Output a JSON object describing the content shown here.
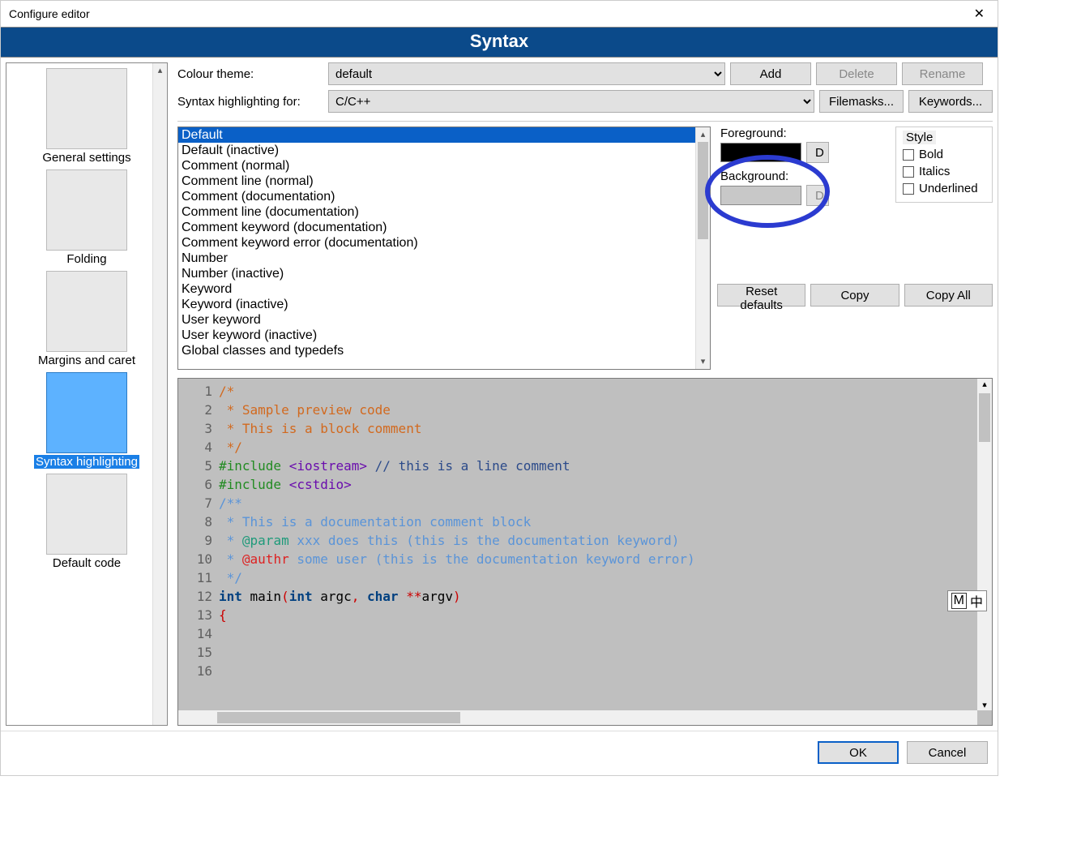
{
  "window": {
    "title": "Configure editor"
  },
  "page_title": "Syntax",
  "sidebar": {
    "items": [
      {
        "label": "General settings",
        "selected": false
      },
      {
        "label": "Folding",
        "selected": false
      },
      {
        "label": "Margins and caret",
        "selected": false
      },
      {
        "label": "Syntax highlighting",
        "selected": true
      },
      {
        "label": "Default code",
        "selected": false
      }
    ]
  },
  "colour_theme": {
    "label": "Colour theme:",
    "value": "default"
  },
  "syntax_for": {
    "label": "Syntax highlighting for:",
    "value": "C/C++"
  },
  "buttons": {
    "add": "Add",
    "delete": "Delete",
    "rename": "Rename",
    "filemasks": "Filemasks...",
    "keywords": "Keywords...",
    "reset": "Reset defaults",
    "copy": "Copy",
    "copyall": "Copy All",
    "ok": "OK",
    "cancel": "Cancel",
    "d": "D"
  },
  "labels": {
    "foreground": "Foreground:",
    "background": "Background:",
    "style": "Style",
    "bold": "Bold",
    "italics": "Italics",
    "underlined": "Underlined"
  },
  "colors": {
    "foreground": "#000000",
    "background": "#c8c8c8"
  },
  "element_list": [
    "Default",
    "Default (inactive)",
    "Comment (normal)",
    "Comment line (normal)",
    "Comment (documentation)",
    "Comment line (documentation)",
    "Comment keyword (documentation)",
    "Comment keyword error (documentation)",
    "Number",
    "Number (inactive)",
    "Keyword",
    "Keyword (inactive)",
    "User keyword",
    "User keyword (inactive)",
    "Global classes and typedefs"
  ],
  "element_selected_index": 0,
  "preview": {
    "line_start": 1,
    "lines": [
      [
        [
          "c-doc",
          "/*"
        ]
      ],
      [
        [
          "c-doc",
          " * Sample preview code"
        ]
      ],
      [
        [
          "c-doc",
          " * This is a block comment"
        ]
      ],
      [
        [
          "c-doc",
          " */"
        ]
      ],
      [
        [
          "",
          ""
        ]
      ],
      [
        [
          "c-pre",
          "#include "
        ],
        [
          "c-inc",
          "<iostream>"
        ],
        [
          "",
          " "
        ],
        [
          "c-lcom",
          "// this is a line comment"
        ]
      ],
      [
        [
          "c-pre",
          "#include "
        ],
        [
          "c-inc",
          "<cstdio>"
        ]
      ],
      [
        [
          "",
          ""
        ]
      ],
      [
        [
          "c-dblk",
          "/**"
        ]
      ],
      [
        [
          "c-dblk",
          " * This is a documentation comment block"
        ]
      ],
      [
        [
          "c-dblk",
          " * "
        ],
        [
          "c-dkw",
          "@param"
        ],
        [
          "c-dblk",
          " xxx does this (this is the documentation keyword)"
        ]
      ],
      [
        [
          "c-dblk",
          " * "
        ],
        [
          "c-dkwe",
          "@authr"
        ],
        [
          "c-dblk",
          " some user (this is the documentation keyword error)"
        ]
      ],
      [
        [
          "c-dblk",
          " */"
        ]
      ],
      [
        [
          "",
          ""
        ]
      ],
      [
        [
          "c-kw",
          "int "
        ],
        [
          "c-id",
          "main"
        ],
        [
          "c-op",
          "("
        ],
        [
          "c-kw",
          "int "
        ],
        [
          "c-id",
          "argc"
        ],
        [
          "c-op",
          ", "
        ],
        [
          "c-kw",
          "char "
        ],
        [
          "c-op",
          "**"
        ],
        [
          "c-id",
          "argv"
        ],
        [
          "c-op",
          ")"
        ]
      ],
      [
        [
          "c-brace",
          "{"
        ]
      ]
    ]
  },
  "ime": {
    "m": "M",
    "lang": "中"
  }
}
